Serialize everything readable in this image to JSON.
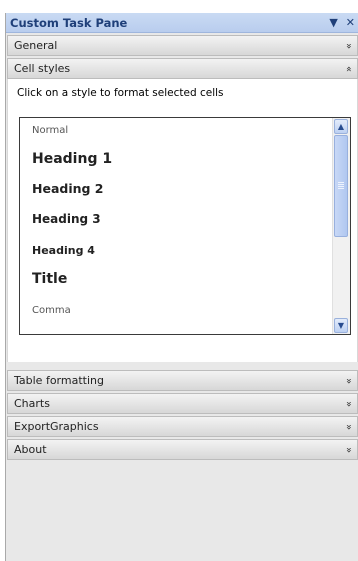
{
  "pane": {
    "title": "Custom Task Pane",
    "dropdown_glyph": "▼",
    "close_glyph": "✕"
  },
  "sections": {
    "general": {
      "label": "General",
      "chevron": "»"
    },
    "cell_styles": {
      "label": "Cell styles",
      "chevron": "«",
      "hint": "Click on a style to format selected cells",
      "styles": [
        "Normal",
        "Heading 1",
        "Heading 2",
        "Heading 3",
        "Heading 4",
        "Title",
        "Comma"
      ]
    },
    "table_formatting": {
      "label": "Table formatting",
      "chevron": "»"
    },
    "charts": {
      "label": "Charts",
      "chevron": "»"
    },
    "export_graphics": {
      "label": "ExportGraphics",
      "chevron": "»"
    },
    "about": {
      "label": "About",
      "chevron": "»"
    }
  },
  "scrollbar": {
    "up_glyph": "▲",
    "down_glyph": "▼"
  }
}
